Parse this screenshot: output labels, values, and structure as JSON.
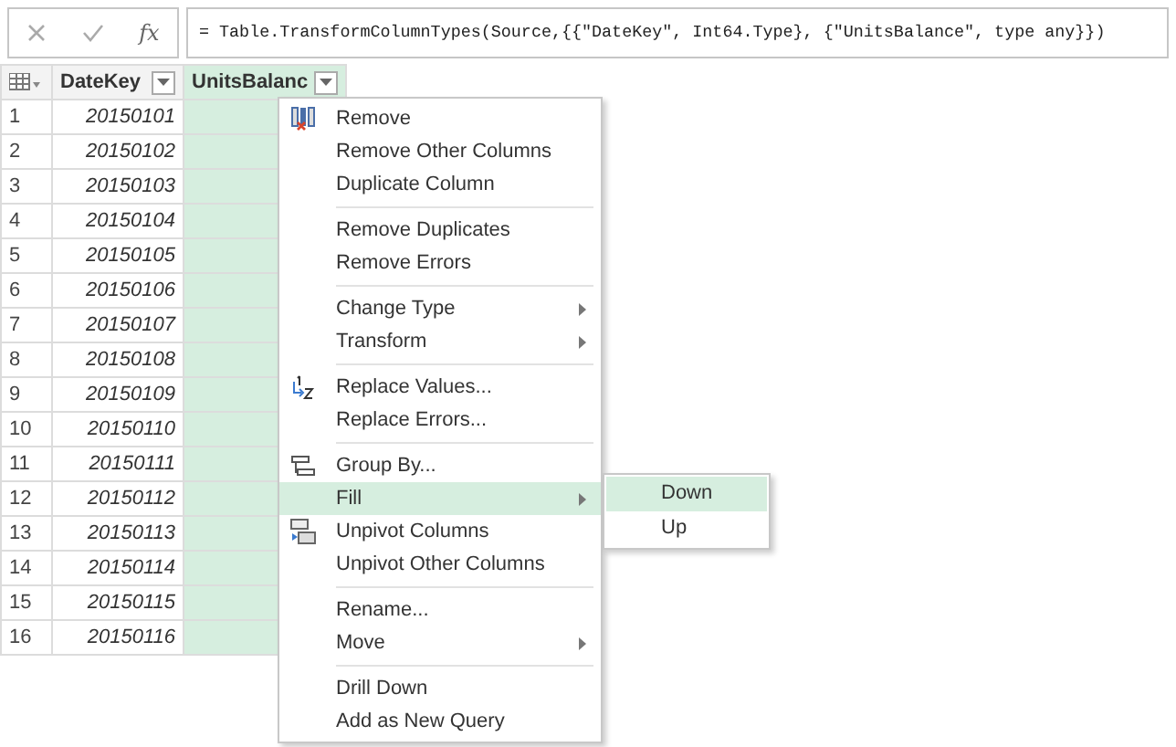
{
  "formula_bar": {
    "fx": "fx",
    "formula": "= Table.TransformColumnTypes(Source,{{\"DateKey\", Int64.Type}, {\"UnitsBalance\", type any}})"
  },
  "table": {
    "columns": [
      {
        "label": "DateKey",
        "selected": false
      },
      {
        "label": "UnitsBalanc",
        "selected": true
      }
    ],
    "rows": [
      {
        "number": "1",
        "date_key": "20150101"
      },
      {
        "number": "2",
        "date_key": "20150102"
      },
      {
        "number": "3",
        "date_key": "20150103"
      },
      {
        "number": "4",
        "date_key": "20150104"
      },
      {
        "number": "5",
        "date_key": "20150105"
      },
      {
        "number": "6",
        "date_key": "20150106"
      },
      {
        "number": "7",
        "date_key": "20150107"
      },
      {
        "number": "8",
        "date_key": "20150108"
      },
      {
        "number": "9",
        "date_key": "20150109"
      },
      {
        "number": "10",
        "date_key": "20150110"
      },
      {
        "number": "11",
        "date_key": "20150111"
      },
      {
        "number": "12",
        "date_key": "20150112"
      },
      {
        "number": "13",
        "date_key": "20150113"
      },
      {
        "number": "14",
        "date_key": "20150114"
      },
      {
        "number": "15",
        "date_key": "20150115"
      },
      {
        "number": "16",
        "date_key": "20150116"
      }
    ]
  },
  "context_menu": {
    "groups": [
      [
        {
          "label": "Remove",
          "submenu": false,
          "selected": false
        },
        {
          "label": "Remove Other Columns",
          "submenu": false,
          "selected": false
        },
        {
          "label": "Duplicate Column",
          "submenu": false,
          "selected": false
        }
      ],
      [
        {
          "label": "Remove Duplicates",
          "submenu": false,
          "selected": false
        },
        {
          "label": "Remove Errors",
          "submenu": false,
          "selected": false
        }
      ],
      [
        {
          "label": "Change Type",
          "submenu": true,
          "selected": false
        },
        {
          "label": "Transform",
          "submenu": true,
          "selected": false
        }
      ],
      [
        {
          "label": "Replace Values...",
          "submenu": false,
          "selected": false
        },
        {
          "label": "Replace Errors...",
          "submenu": false,
          "selected": false
        }
      ],
      [
        {
          "label": "Group By...",
          "submenu": false,
          "selected": false
        },
        {
          "label": "Fill",
          "submenu": true,
          "selected": true
        },
        {
          "label": "Unpivot Columns",
          "submenu": false,
          "selected": false
        },
        {
          "label": "Unpivot Other Columns",
          "submenu": false,
          "selected": false
        }
      ],
      [
        {
          "label": "Rename...",
          "submenu": false,
          "selected": false
        },
        {
          "label": "Move",
          "submenu": true,
          "selected": false
        }
      ],
      [
        {
          "label": "Drill Down",
          "submenu": false,
          "selected": false
        },
        {
          "label": "Add as New Query",
          "submenu": false,
          "selected": false
        }
      ]
    ]
  },
  "submenu": {
    "items": [
      {
        "label": "Down",
        "selected": true
      },
      {
        "label": "Up",
        "selected": false
      }
    ]
  }
}
